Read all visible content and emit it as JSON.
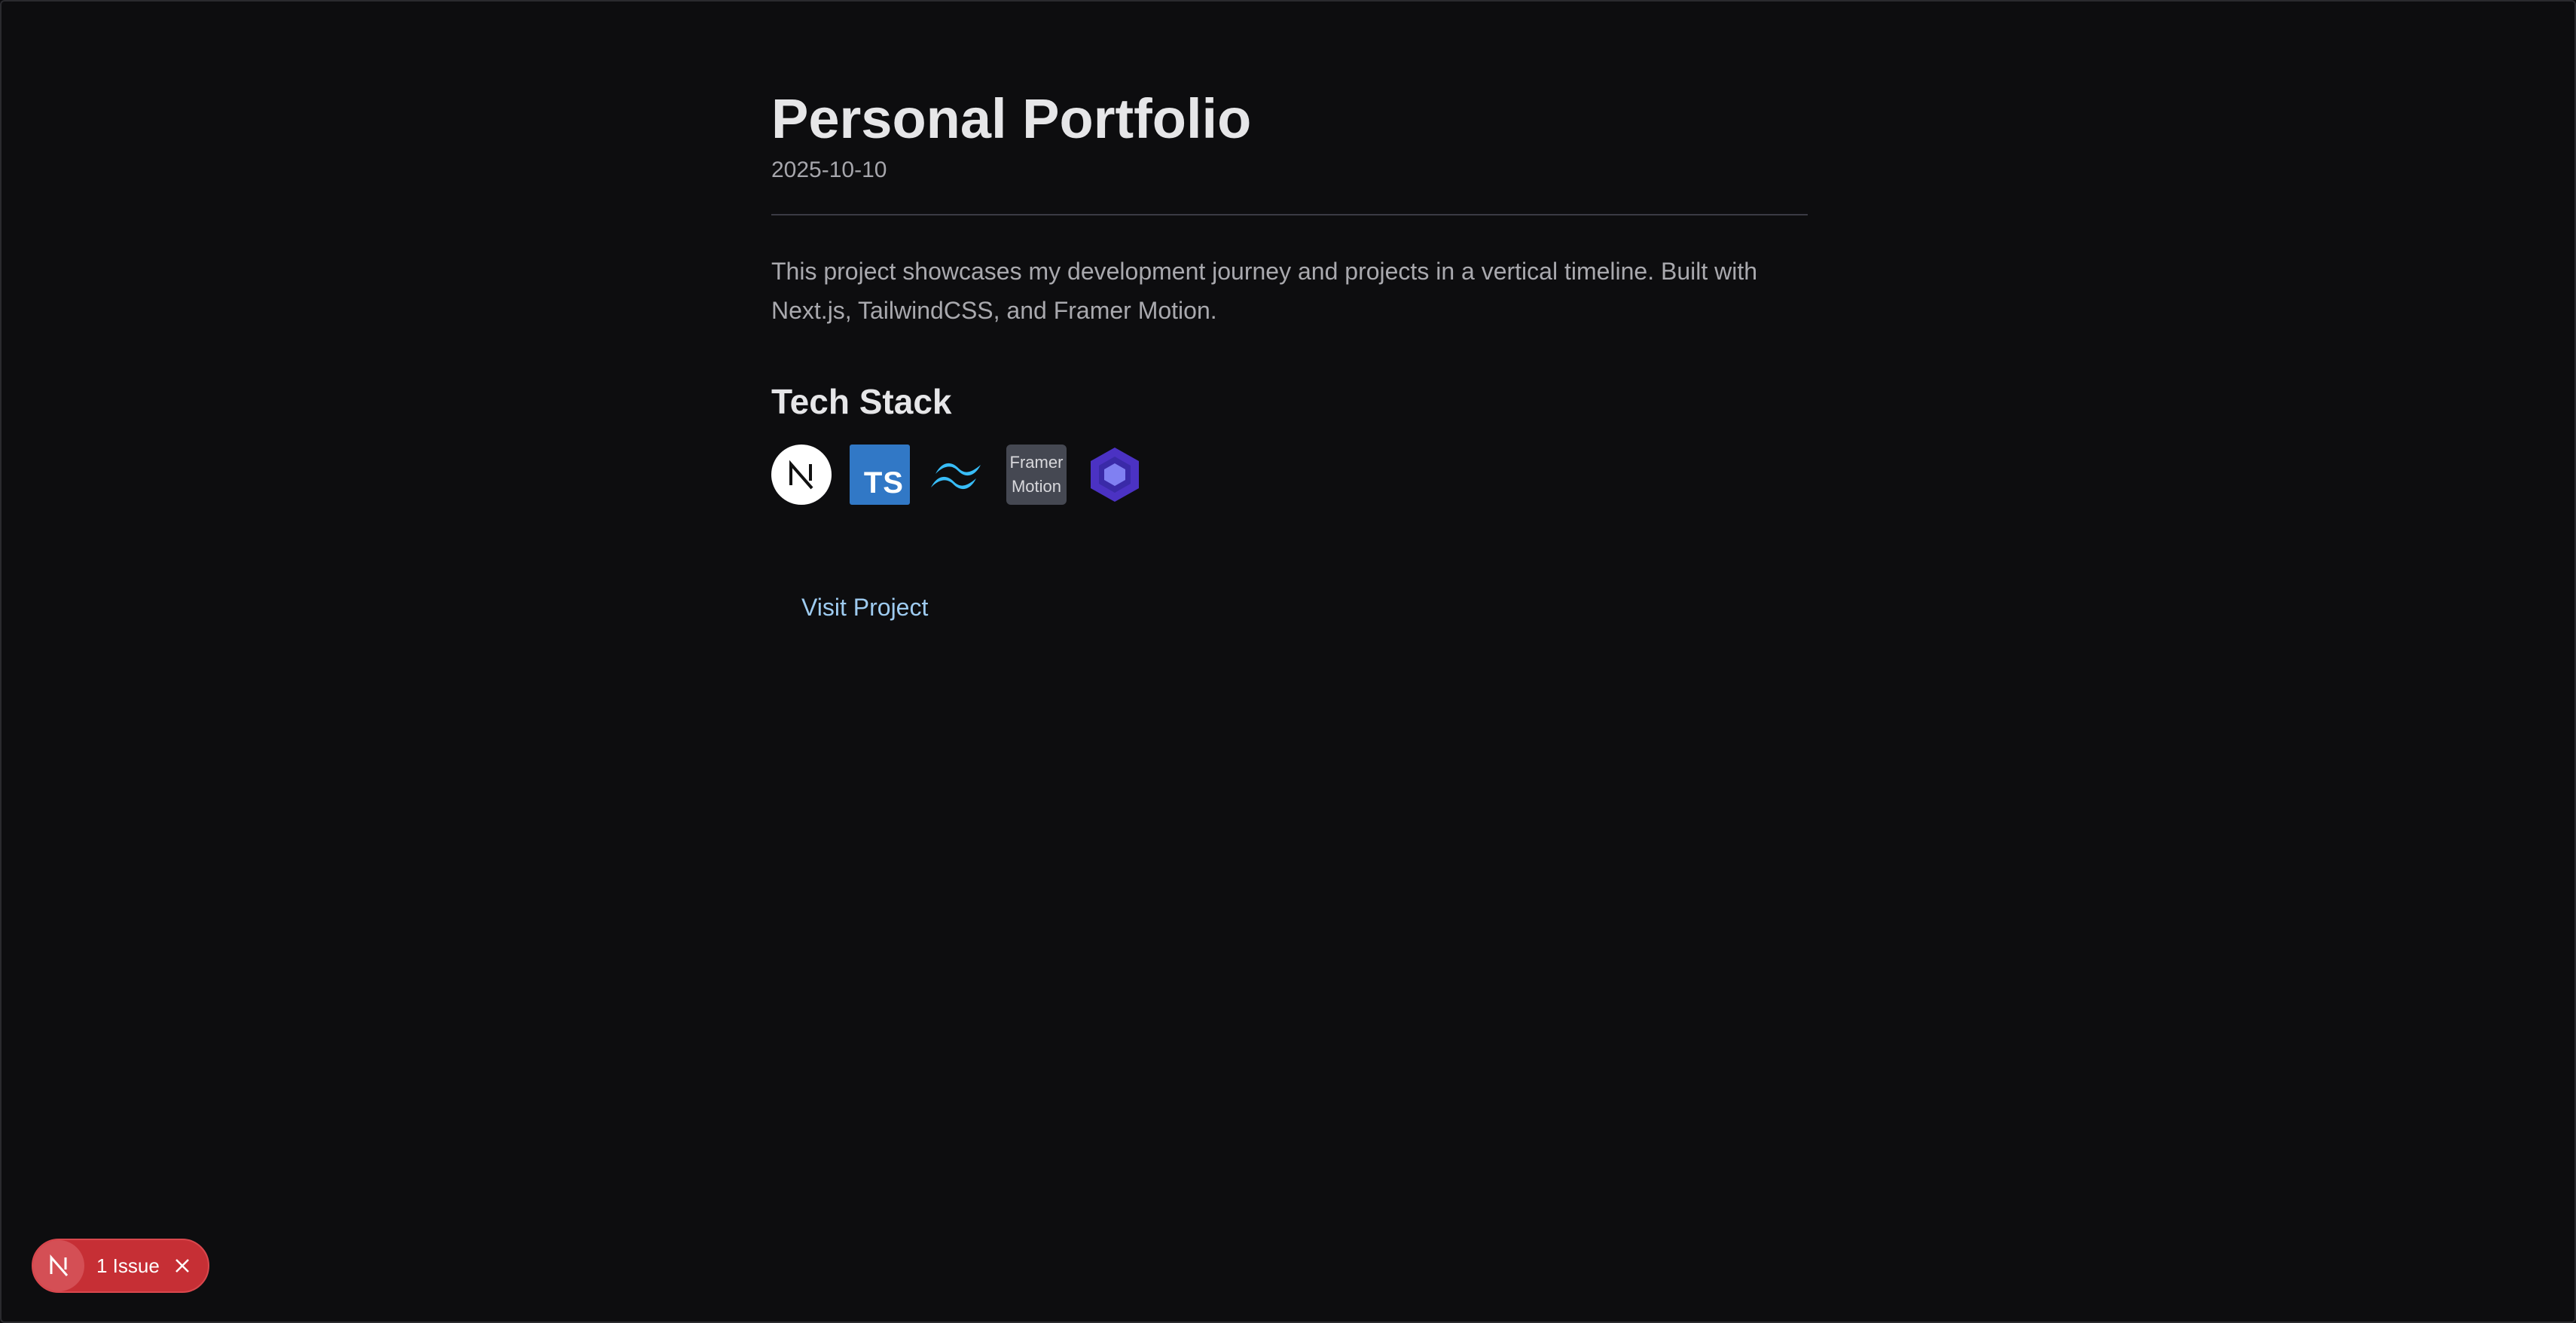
{
  "project": {
    "title": "Personal Portfolio",
    "date": "2025-10-10",
    "description": "This project showcases my development journey and projects in a vertical timeline. Built with Next.js, TailwindCSS, and Framer Motion."
  },
  "tech_stack": {
    "heading": "Tech Stack",
    "items": [
      {
        "icon": "nextjs-icon"
      },
      {
        "icon": "typescript-icon",
        "label": "TS"
      },
      {
        "icon": "tailwindcss-icon"
      },
      {
        "icon": "framer-motion-icon",
        "label": "Framer\nMotion"
      },
      {
        "icon": "eslint-icon"
      }
    ]
  },
  "link": {
    "visit_label": "Visit Project"
  },
  "dev_overlay": {
    "issue_label": "1 Issue",
    "logo_icon": "nextjs-logo-icon",
    "close_icon": "close-icon"
  },
  "colors": {
    "background": "#0d0d0f",
    "link": "#9ecbf0",
    "issue_pill": "#c62f35",
    "typescript": "#3178c6",
    "tailwind": "#38bdf8",
    "eslint": "#4b32c3"
  }
}
